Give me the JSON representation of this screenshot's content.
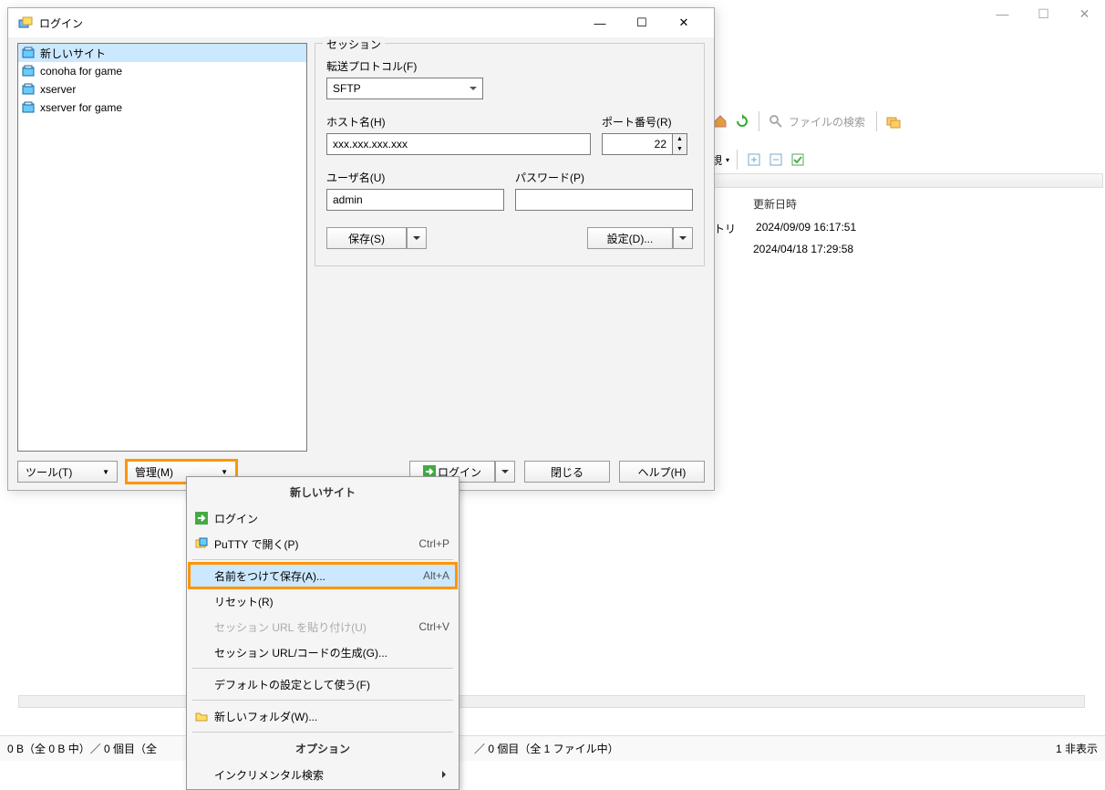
{
  "bgWindow": {
    "toolbar": {
      "searchLabel": "ファイルの検索",
      "newLabel": "規"
    },
    "list": {
      "header": "更新日時",
      "row1tag": "トリ",
      "row1date": "2024/09/09 16:17:51",
      "row2date": "2024/04/18 17:29:58"
    },
    "status": {
      "left": "0 B（全 0 B 中）／ 0 個目（全",
      "center": "／ 0 個目（全 1 ファイル中）",
      "right": "1 非表示"
    }
  },
  "dialog": {
    "title": "ログイン",
    "sites": [
      {
        "label": "新しいサイト",
        "type": "new",
        "selected": true
      },
      {
        "label": "conoha for game",
        "type": "site",
        "selected": false
      },
      {
        "label": "xserver",
        "type": "site",
        "selected": false
      },
      {
        "label": "xserver for game",
        "type": "site",
        "selected": false
      }
    ],
    "session": {
      "legend": "セッション",
      "protocolLabel": "転送プロトコル(F)",
      "protocolValue": "SFTP",
      "hostLabel": "ホスト名(H)",
      "hostValue": "xxx.xxx.xxx.xxx",
      "portLabel": "ポート番号(R)",
      "portValue": "22",
      "userLabel": "ユーザ名(U)",
      "userValue": "admin",
      "passLabel": "パスワード(P)",
      "passValue": "",
      "saveBtn": "保存(S)",
      "advancedBtn": "設定(D)..."
    },
    "footer": {
      "tools": "ツール(T)",
      "manage": "管理(M)",
      "login": "ログイン",
      "close": "閉じる",
      "help": "ヘルプ(H)"
    }
  },
  "menu": {
    "title": "新しいサイト",
    "items": [
      {
        "label": "ログイン",
        "icon": "login",
        "enabled": true
      },
      {
        "label": "PuTTY で開く(P)",
        "icon": "putty",
        "shortcut": "Ctrl+P",
        "enabled": true
      },
      {
        "sep": true
      },
      {
        "label": "名前をつけて保存(A)...",
        "shortcut": "Alt+A",
        "enabled": true,
        "highlighted": true
      },
      {
        "label": "リセット(R)",
        "enabled": true
      },
      {
        "label": "セッション URL を貼り付け(U)",
        "shortcut": "Ctrl+V",
        "enabled": false
      },
      {
        "label": "セッション URL/コードの生成(G)...",
        "enabled": true
      },
      {
        "sep": true
      },
      {
        "label": "デフォルトの設定として使う(F)",
        "enabled": true
      },
      {
        "sep": true
      },
      {
        "label": "新しいフォルダ(W)...",
        "icon": "folder",
        "enabled": true
      },
      {
        "sep": true
      },
      {
        "label": "オプション",
        "title2": true
      },
      {
        "label": "インクリメンタル検索",
        "sub": true,
        "enabled": true
      }
    ]
  }
}
